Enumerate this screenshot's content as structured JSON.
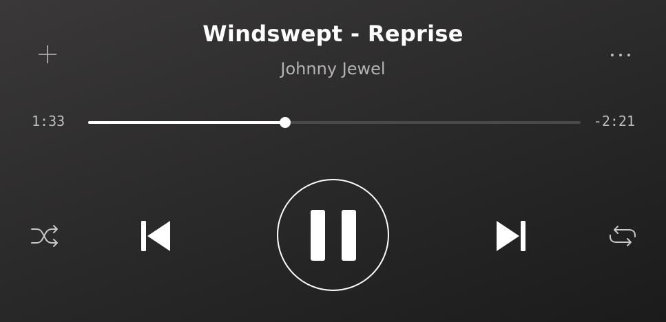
{
  "track": {
    "title": "Windswept - Reprise",
    "artist": "Johnny Jewel"
  },
  "progress": {
    "elapsed": "1:33",
    "remaining": "-2:21",
    "fraction": 0.4
  },
  "icons": {
    "add": "plus-icon",
    "more": "more-horizontal-icon",
    "shuffle": "shuffle-icon",
    "previous": "skip-previous-icon",
    "play_state": "pause-icon",
    "next": "skip-next-icon",
    "repeat": "repeat-icon"
  },
  "colors": {
    "background_top": "#3a3838",
    "background_bottom": "#1c1b1b",
    "primary_text": "#ffffff",
    "secondary_text": "#b3b3b3",
    "track_empty": "#4a4949",
    "track_fill": "#ffffff"
  }
}
